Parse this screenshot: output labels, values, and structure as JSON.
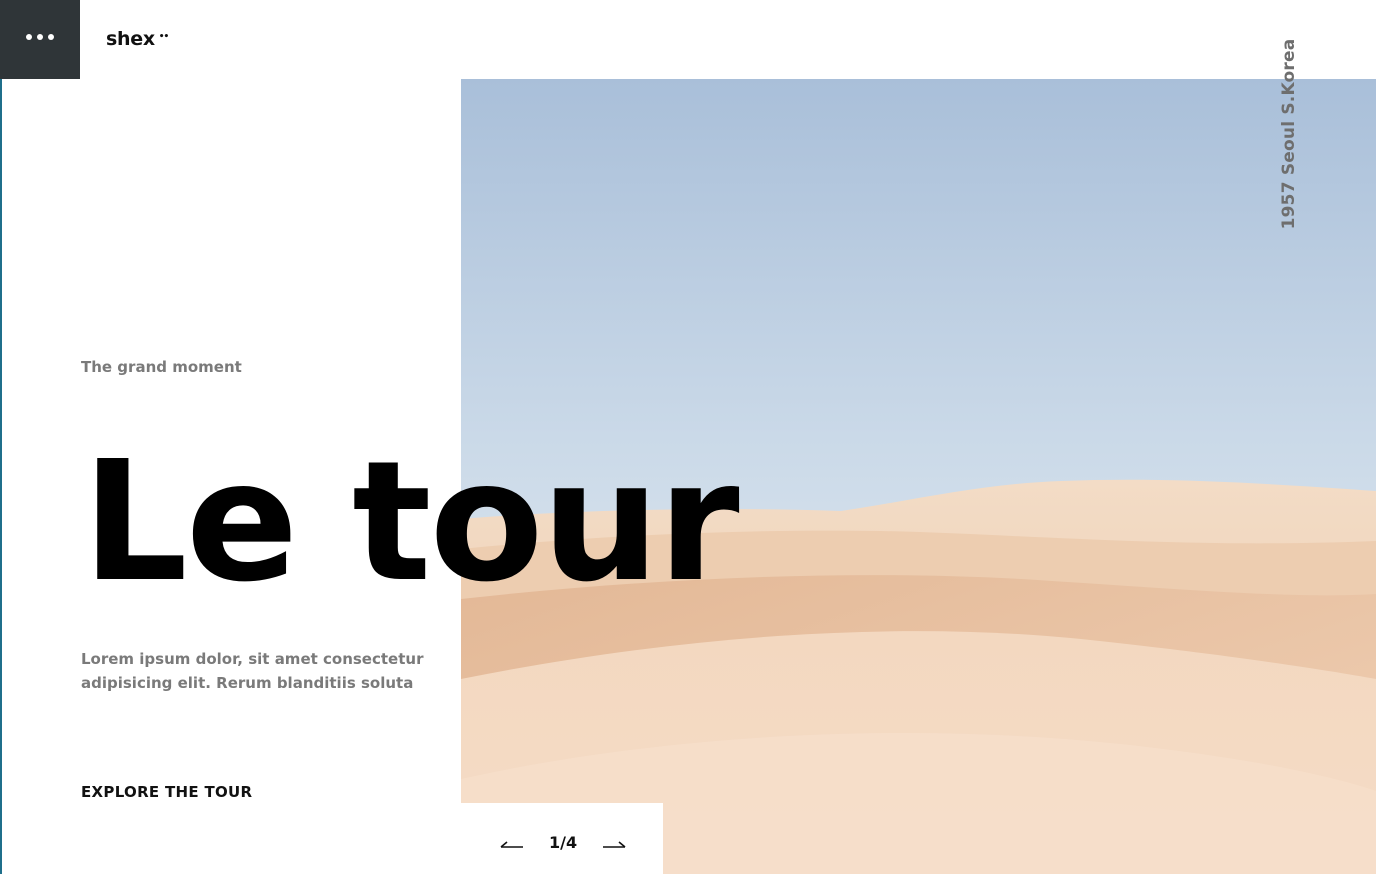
{
  "menu": {
    "icon": "more-horizontal-icon"
  },
  "brand": {
    "name": "shex",
    "mark": "••"
  },
  "hero": {
    "location": "1957 Seoul S.Korea",
    "subtitle": "The grand moment",
    "title": "Le tour",
    "description": "Lorem ipsum dolor, sit amet consectetur adipisicing elit. Rerum blanditiis soluta",
    "cta_label": "EXPLORE THE TOUR"
  },
  "pager": {
    "counter": "1/4",
    "prev_icon": "arrow-left-icon",
    "next_icon": "arrow-right-icon"
  },
  "colors": {
    "menu_bg": "#2f3538",
    "sky_top": "#a9bfd9",
    "sky_bottom": "#e8eef4",
    "sand_light": "#f2d7bf",
    "sand_dark": "#dcae8c",
    "muted_text": "#7a7a7a"
  }
}
